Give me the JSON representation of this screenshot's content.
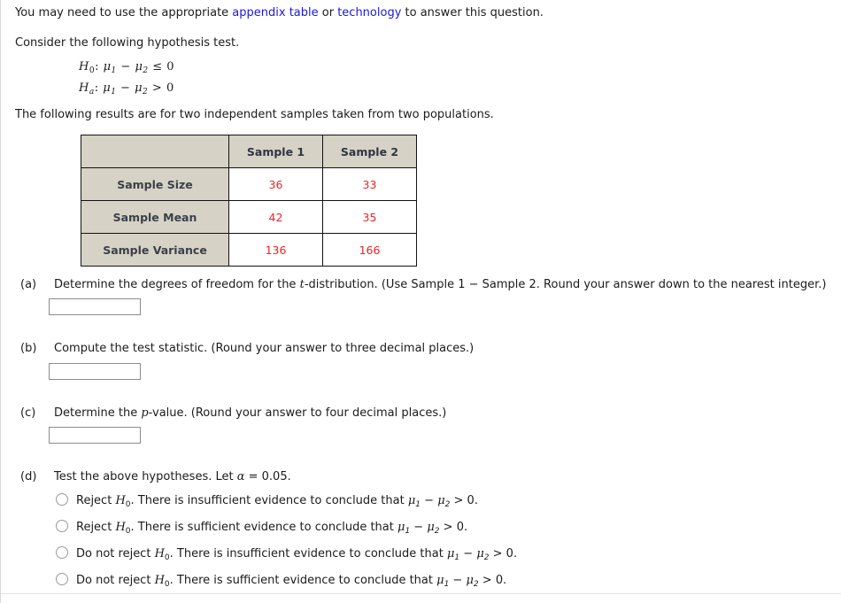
{
  "intro": {
    "before_link1": "You may need to use the appropriate ",
    "link1": "appendix table",
    "between_links": " or ",
    "link2": "technology",
    "after_link2": " to answer this question.",
    "consider": "Consider the following hypothesis test.",
    "results": "The following results are for two independent samples taken from two populations."
  },
  "hypothesis": {
    "null_label": "H",
    "null_sub": "0",
    "null_body": ": μ",
    "null_text": "H₀: μ₁ − μ₂ ≤ 0",
    "alt_text": "Hₐ: μ₁ − μ₂ > 0",
    "null_sub1": "1",
    "null_minus": " − μ",
    "null_sub2": "2",
    "null_op": " ≤ 0",
    "alt_label": "H",
    "alt_sub": "a",
    "alt_op": " > 0"
  },
  "table": {
    "corner": "",
    "columns": [
      "Sample 1",
      "Sample 2"
    ],
    "rows": [
      {
        "label": "Sample Size",
        "values": [
          "36",
          "33"
        ]
      },
      {
        "label": "Sample Mean",
        "values": [
          "42",
          "35"
        ]
      },
      {
        "label": "Sample Variance",
        "values": [
          "136",
          "166"
        ]
      }
    ]
  },
  "parts": {
    "a": {
      "tag": "(a)",
      "text_1": "Determine the degrees of freedom for the ",
      "italic": "t",
      "text_2": "-distribution. (Use Sample 1 − Sample 2. Round your answer down to the nearest integer.)",
      "input_value": "",
      "input_placeholder": ""
    },
    "b": {
      "tag": "(b)",
      "text_1": "Compute the test statistic. (Round your answer to three decimal places.)",
      "input_value": "",
      "input_placeholder": ""
    },
    "c": {
      "tag": "(c)",
      "text_1": "Determine the ",
      "italic": "p",
      "text_2": "-value. (Round your answer to four decimal places.)",
      "input_value": "",
      "input_placeholder": ""
    },
    "d": {
      "tag": "(d)",
      "text_1": "Test the above hypotheses. Let ",
      "alpha": "α",
      "text_2": " = 0.05.",
      "options": [
        "Reject H₀. There is insufficient evidence to conclude that μ₁ − μ₂ > 0.",
        "Reject H₀. There is sufficient evidence to conclude that μ₁ − μ₂ > 0.",
        "Do not reject H₀. There is insufficient evidence to conclude that μ₁ − μ₂ > 0.",
        "Do not reject H₀. There is sufficient evidence to conclude that μ₁ − μ₂ > 0."
      ],
      "option_parts": [
        {
          "lead": "Reject ",
          "h": "H",
          "hsub": "0",
          "mid": ". There is insufficient evidence to conclude that ",
          "mu1": "μ",
          "s1": "1",
          "minus": " − ",
          "mu2": "μ",
          "s2": "2",
          "tail": " > 0."
        },
        {
          "lead": "Reject ",
          "h": "H",
          "hsub": "0",
          "mid": ". There is sufficient evidence to conclude that ",
          "mu1": "μ",
          "s1": "1",
          "minus": " − ",
          "mu2": "μ",
          "s2": "2",
          "tail": " > 0."
        },
        {
          "lead": "Do not reject ",
          "h": "H",
          "hsub": "0",
          "mid": ". There is insufficient evidence to conclude that ",
          "mu1": "μ",
          "s1": "1",
          "minus": " − ",
          "mu2": "μ",
          "s2": "2",
          "tail": " > 0."
        },
        {
          "lead": "Do not reject ",
          "h": "H",
          "hsub": "0",
          "mid": ". There is sufficient evidence to conclude that ",
          "mu1": "μ",
          "s1": "1",
          "minus": " − ",
          "mu2": "μ",
          "s2": "2",
          "tail": " > 0."
        }
      ]
    }
  },
  "colors": {
    "link": "#1919e6",
    "table_header_bg": "#d6d2c5",
    "table_value": "#ef2222",
    "text": "#1b1b1b"
  }
}
